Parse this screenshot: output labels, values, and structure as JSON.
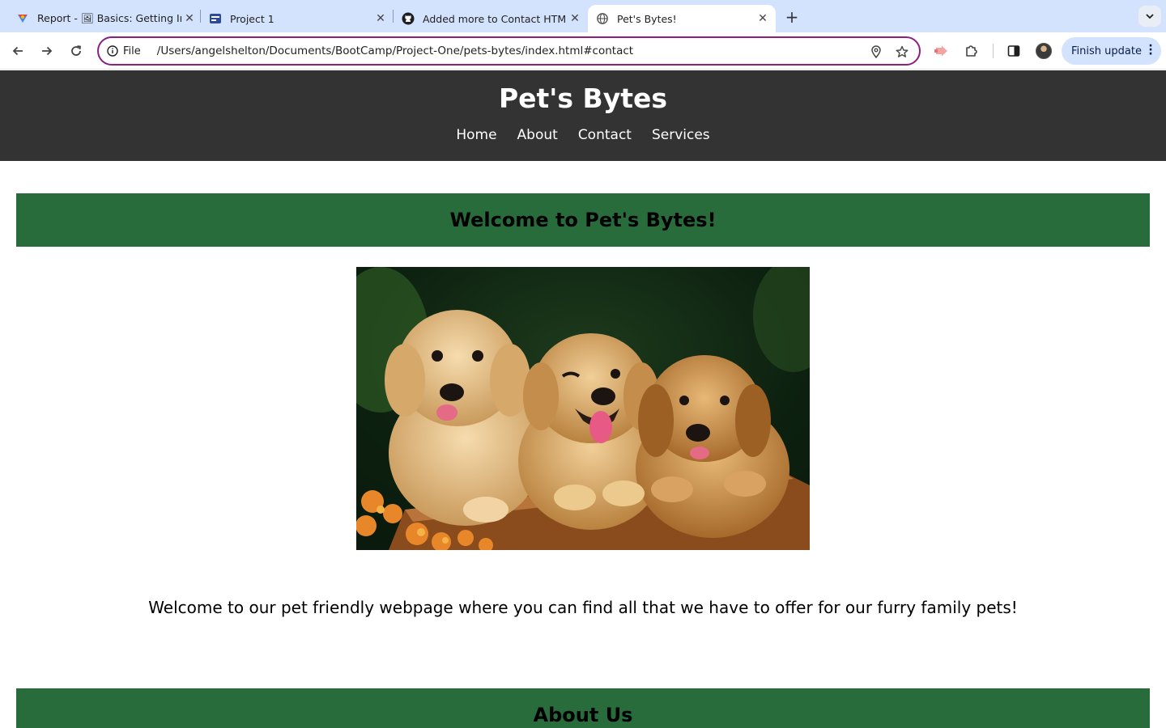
{
  "browser": {
    "tabs": [
      {
        "title": "Report - 🖼 Basics: Getting In",
        "icon": "report-app-icon",
        "active": false
      },
      {
        "title": "Project 1",
        "icon": "project-icon",
        "active": false
      },
      {
        "title": "Added more to Contact HTML",
        "icon": "github-icon",
        "active": false
      },
      {
        "title": "Pet's Bytes!",
        "icon": "globe-icon",
        "active": true
      }
    ],
    "omnibox": {
      "scheme_label": "File",
      "url": "/Users/angelshelton/Documents/BootCamp/Project-One/pets-bytes/index.html#contact"
    },
    "finish_update_label": "Finish update"
  },
  "page": {
    "site_title": "Pet's Bytes",
    "nav": [
      "Home",
      "About",
      "Contact",
      "Services"
    ],
    "welcome_heading": "Welcome to Pet's Bytes!",
    "hero_alt": "puppies-image",
    "intro_text": "Welcome to our pet friendly webpage where you can find all that we have to offer for our furry family pets!",
    "about_heading": "About Us"
  },
  "colors": {
    "header_bg": "#333333",
    "section_green": "#276c3a",
    "tabstrip_bg": "#d3e3fd",
    "omnibox_border": "#8c1f86"
  }
}
